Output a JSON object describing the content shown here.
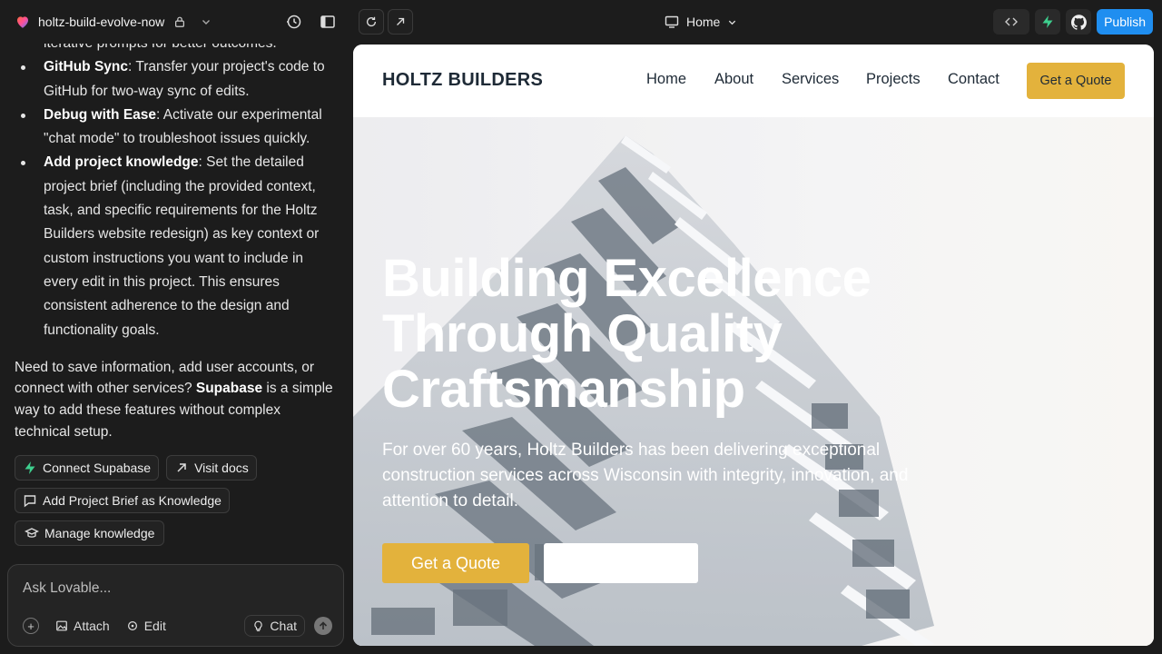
{
  "app": {
    "project_name": "holtz-build-evolve-now",
    "route_label": "Home",
    "publish_label": "Publish"
  },
  "chat": {
    "partial_line": "iterative prompts for better outcomes.",
    "bullets": [
      {
        "title": "GitHub Sync",
        "text": ": Transfer your project's code to GitHub for two-way sync of edits."
      },
      {
        "title": "Debug with Ease",
        "text": ": Activate our experimental \"chat mode\" to troubleshoot issues quickly."
      },
      {
        "title": "Add project knowledge",
        "text": ": Set the detailed project brief (including the provided context, task, and specific requirements for the Holtz Builders website redesign) as key context or custom instructions you want to include in every edit in this project. This ensures consistent adherence to the design and functionality goals."
      }
    ],
    "supabase_pre": "Need to save information, add user accounts, or connect with other services? ",
    "supabase_bold": "Supabase",
    "supabase_post": " is a simple way to add these features without complex technical setup.",
    "actions": {
      "connect_supabase": "Connect Supabase",
      "visit_docs": "Visit docs",
      "add_brief": "Add Project Brief as Knowledge",
      "manage_knowledge": "Manage knowledge"
    },
    "input": {
      "placeholder": "Ask Lovable...",
      "attach": "Attach",
      "edit": "Edit",
      "chat_mode": "Chat"
    }
  },
  "site": {
    "brand": "HOLTZ BUILDERS",
    "nav": [
      "Home",
      "About",
      "Services",
      "Projects",
      "Contact"
    ],
    "nav_cta": "Get a Quote",
    "hero_title": "Building Excellence Through Quality Craftsmanship",
    "hero_subtitle": "For over 60 years, Holtz Builders has been delivering exceptional construction services across Wisconsin with integrity, innovation, and attention to detail.",
    "hero_cta": "Get a Quote"
  },
  "colors": {
    "accent": "#e3b23c",
    "publish": "#1f8ef0",
    "supabase": "#3ecf8e",
    "brand_text": "#1e2a36"
  }
}
